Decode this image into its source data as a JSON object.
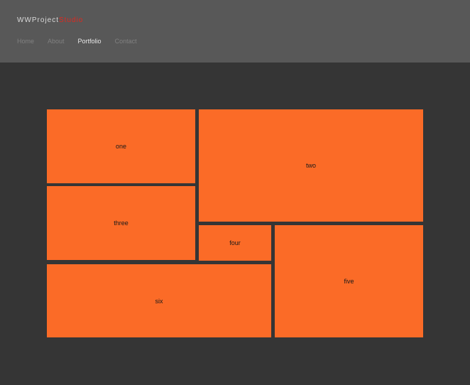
{
  "header": {
    "brand_main": "WWProject",
    "brand_accent": "Studio",
    "nav": [
      "Home",
      "About",
      "Portfolio",
      "Contact"
    ],
    "active_nav": "Portfolio"
  },
  "colors": {
    "page_background": "#353535",
    "header_background": "#585858",
    "tile": "#fb6b27",
    "brand_accent": "#e0281f",
    "nav_inactive": "#808080",
    "nav_active": "#e8e8e8"
  },
  "portfolio": {
    "tiles": [
      "one",
      "two",
      "three",
      "four",
      "five",
      "six"
    ]
  }
}
